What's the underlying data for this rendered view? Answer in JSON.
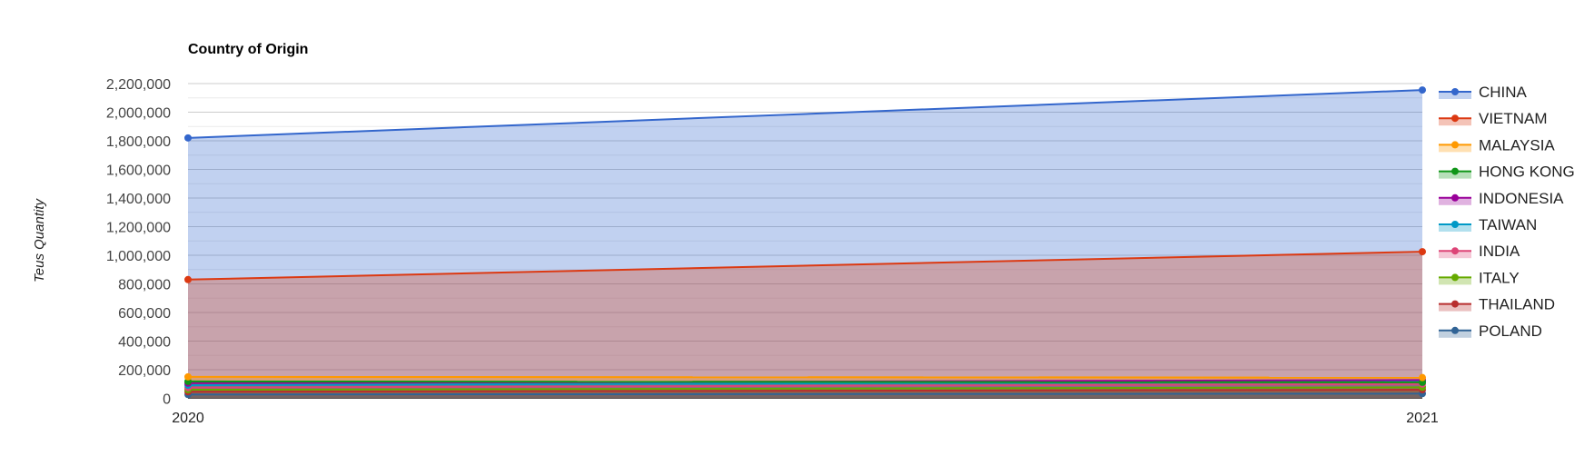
{
  "chart_data": {
    "type": "area",
    "title": "Country of Origin",
    "xlabel": "",
    "ylabel": "Teus Quantity",
    "x": [
      "2020",
      "2021"
    ],
    "ylim": [
      0,
      2200000
    ],
    "yticks": [
      0,
      200000,
      400000,
      600000,
      800000,
      1000000,
      1200000,
      1400000,
      1600000,
      1800000,
      2000000,
      2200000
    ],
    "ytick_labels": [
      "0",
      "200,000",
      "400,000",
      "600,000",
      "800,000",
      "1,000,000",
      "1,200,000",
      "1,400,000",
      "1,600,000",
      "1,800,000",
      "2,000,000",
      "2,200,000"
    ],
    "grid": true,
    "legend_position": "right",
    "series": [
      {
        "name": "CHINA",
        "color": "#3366cc",
        "values": [
          1820000,
          2155000
        ]
      },
      {
        "name": "VIETNAM",
        "color": "#dc3912",
        "values": [
          830000,
          1025000
        ]
      },
      {
        "name": "MALAYSIA",
        "color": "#ff9900",
        "values": [
          150000,
          145000
        ]
      },
      {
        "name": "HONG KONG",
        "color": "#109618",
        "values": [
          118000,
          112000
        ]
      },
      {
        "name": "INDONESIA",
        "color": "#990099",
        "values": [
          106000,
          128000
        ]
      },
      {
        "name": "TAIWAN",
        "color": "#0099c6",
        "values": [
          92000,
          117000
        ]
      },
      {
        "name": "INDIA",
        "color": "#dd4477",
        "values": [
          75000,
          100000
        ]
      },
      {
        "name": "ITALY",
        "color": "#66aa00",
        "values": [
          60000,
          77000
        ]
      },
      {
        "name": "THAILAND",
        "color": "#b82e2e",
        "values": [
          46000,
          60000
        ]
      },
      {
        "name": "POLAND",
        "color": "#316395",
        "values": [
          27000,
          33000
        ]
      }
    ]
  }
}
